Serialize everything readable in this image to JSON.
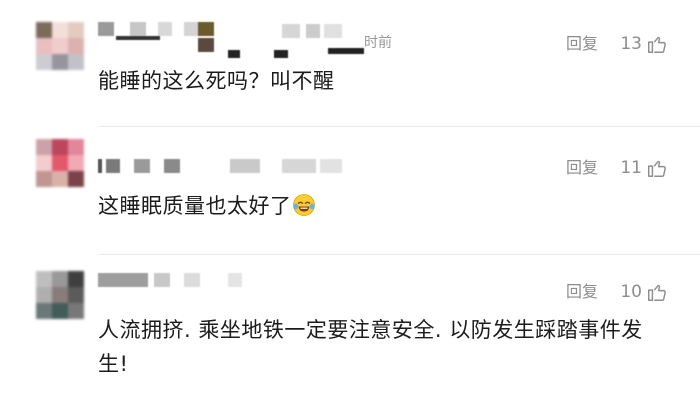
{
  "comments": [
    {
      "avatar_colors": [
        "#6e5a4a",
        "#f3dcd4",
        "#e0c6bb",
        "#e9b8ba",
        "#f0c7c8",
        "#d9a9a8",
        "#c9c7cf",
        "#8c8a92",
        "#bdbbc3"
      ],
      "time": "时前",
      "reply_label": "回复",
      "likes": "13",
      "text": "能睡的这么死吗？叫不醒"
    },
    {
      "avatar_colors": [
        "#c7979e",
        "#b5324a",
        "#e07891",
        "#f2c7c9",
        "#e2465d",
        "#f0a1ab",
        "#b98b86",
        "#d7a9a0",
        "#6b2f36"
      ],
      "reply_label": "回复",
      "likes": "11",
      "text": "这睡眠质量也太好了",
      "emoji": "laughing-tears-emoji"
    },
    {
      "avatar_colors": [
        "#b8b8b8",
        "#8e8e8e",
        "#2b2b2b",
        "#a7a7a7",
        "#7d6e6e",
        "#4a4a4a",
        "#5a6a6a",
        "#2f4a48",
        "#6a6a6a"
      ],
      "reply_label": "回复",
      "likes": "10",
      "text": "人流拥挤. 乘坐地铁一定要注意安全. 以防发生踩踏事件发生!"
    }
  ],
  "colors": {
    "meta_text": "#8d8d8d",
    "body_text": "#1c1c1c",
    "divider": "#ebebeb"
  }
}
